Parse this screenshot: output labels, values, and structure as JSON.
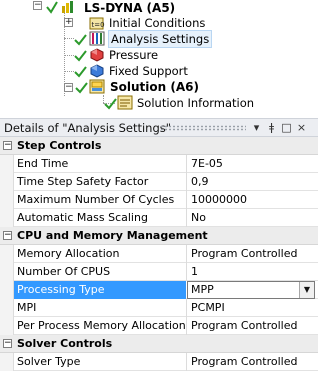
{
  "tree": {
    "root_label": "LS-DYNA (A5)",
    "items": [
      {
        "label": "Initial Conditions",
        "icon": "initial-conditions-icon"
      },
      {
        "label": "Analysis Settings",
        "icon": "analysis-settings-icon",
        "selected": true
      },
      {
        "label": "Pressure",
        "icon": "pressure-icon"
      },
      {
        "label": "Fixed Support",
        "icon": "fixed-support-icon"
      }
    ],
    "solution_label": "Solution (A6)",
    "solution_child_label": "Solution Information"
  },
  "details": {
    "title": "Details of \"Analysis Settings\"",
    "buttons": {
      "menu": "▾",
      "pin": "ǂ",
      "maximize": "□",
      "close": "×"
    }
  },
  "sections": [
    {
      "title": "Step Controls",
      "rows": [
        {
          "name": "End Time",
          "value": "7E-05"
        },
        {
          "name": "Time Step Safety Factor",
          "value": "0,9"
        },
        {
          "name": "Maximum Number Of Cycles",
          "value": "10000000"
        },
        {
          "name": "Automatic Mass Scaling",
          "value": "No"
        }
      ]
    },
    {
      "title": "CPU and Memory Management",
      "rows": [
        {
          "name": "Memory Allocation",
          "value": "Program Controlled"
        },
        {
          "name": "Number Of CPUS",
          "value": "1"
        },
        {
          "name": "Processing Type",
          "value": "MPP",
          "selected": true,
          "dropdown": true
        },
        {
          "name": "MPI",
          "value": "PCMPI"
        },
        {
          "name": "Per Process Memory Allocation",
          "value": "Program Controlled"
        }
      ]
    },
    {
      "title": "Solver Controls",
      "rows": [
        {
          "name": "Solver Type",
          "value": "Program Controlled"
        }
      ]
    }
  ],
  "colors": {
    "selection": "#3399ff",
    "section_bg": "#ececec",
    "header_bg": "#eceef2"
  }
}
